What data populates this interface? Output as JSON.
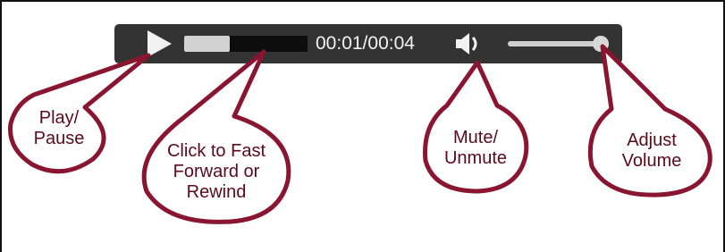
{
  "player": {
    "time_display": "00:01/00:04",
    "progress_fraction": 0.37,
    "volume_fraction": 1.0,
    "icons": {
      "play": "play-icon",
      "mute": "speaker-icon"
    },
    "colors": {
      "bar": "#333333",
      "track": "#0d0d0d",
      "fill": "#d2d2d2"
    }
  },
  "callouts": {
    "play_pause": [
      "Play/",
      "Pause"
    ],
    "seek": [
      "Click to Fast",
      "Forward or",
      "Rewind"
    ],
    "mute": [
      "Mute/",
      "Unmute"
    ],
    "volume": [
      "Adjust",
      "Volume"
    ],
    "colors": {
      "fill": "#ffffff",
      "stroke": "#8a1530",
      "text": "#5a0a1a"
    }
  }
}
